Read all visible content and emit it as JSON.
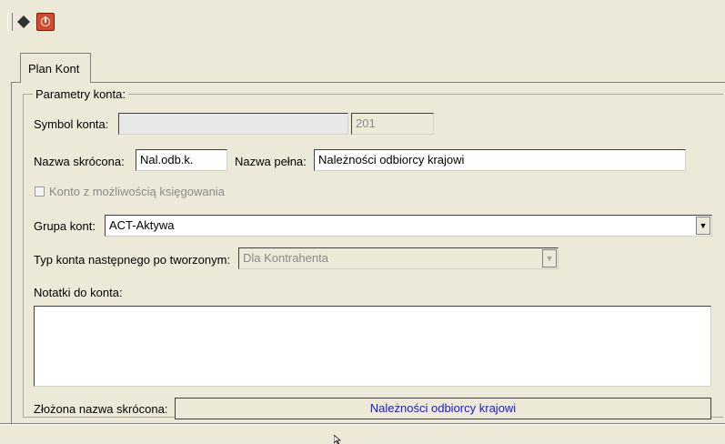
{
  "tabs": [
    {
      "label": "Plan Kont"
    }
  ],
  "group": {
    "legend": "Parametry konta:"
  },
  "symbol": {
    "label": "Symbol konta:",
    "prefix_value": "",
    "value": "201"
  },
  "short_name": {
    "label": "Nazwa skrócona:",
    "value": "Nal.odb.k."
  },
  "full_name": {
    "label": "Nazwa pełna:",
    "value": "Należności  odbiorcy krajowi"
  },
  "posting": {
    "label": "Konto z możliwością księgowania",
    "checked": false
  },
  "account_group": {
    "label": "Grupa kont:",
    "value": "ACT-Aktywa"
  },
  "next_type": {
    "label": "Typ konta następnego po tworzonym:",
    "value": "Dla Kontrahenta"
  },
  "notes": {
    "label": "Notatki do konta:",
    "value": ""
  },
  "composite": {
    "label": "Złożona nazwa skrócona:",
    "value": "Należności  odbiorcy krajowi"
  },
  "colors": {
    "background": "#ece9d8",
    "power_button": "#d64a2e",
    "composite_text": "#1a1acd"
  },
  "icons": [
    "toolbar-grip-icon",
    "diamond-icon",
    "power-icon",
    "dropdown-arrow-icon"
  ]
}
